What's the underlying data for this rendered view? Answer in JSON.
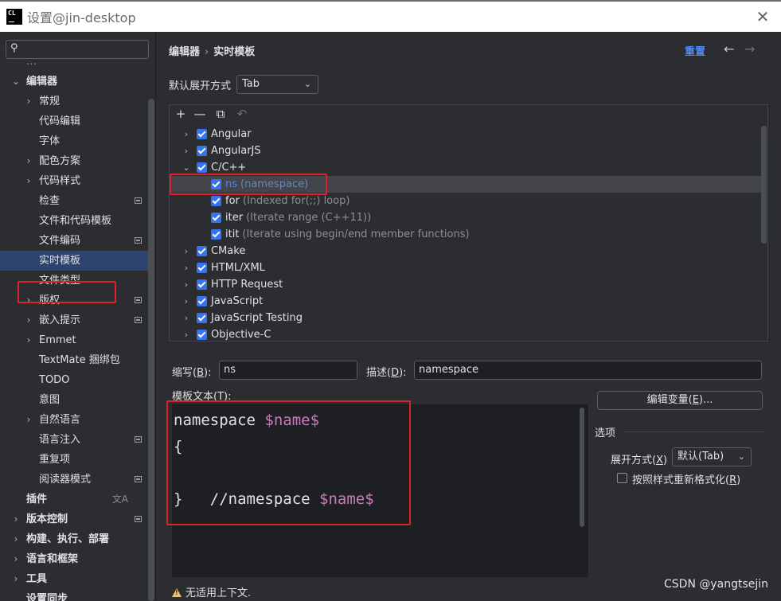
{
  "window": {
    "title": "设置@jin-desktop",
    "app_icon_text": "CL",
    "close": "✕"
  },
  "sidebar": {
    "search_placeholder": "",
    "items": [
      {
        "label": "编辑器",
        "level": 0,
        "bold": true,
        "expanded": true
      },
      {
        "label": "常规",
        "level": 1,
        "chevron": true
      },
      {
        "label": "代码编辑",
        "level": 1
      },
      {
        "label": "字体",
        "level": 1
      },
      {
        "label": "配色方案",
        "level": 1,
        "chevron": true
      },
      {
        "label": "代码样式",
        "level": 1,
        "chevron": true
      },
      {
        "label": "检查",
        "level": 1,
        "mark": true
      },
      {
        "label": "文件和代码模板",
        "level": 1
      },
      {
        "label": "文件编码",
        "level": 1,
        "mark": true
      },
      {
        "label": "实时模板",
        "level": 1,
        "selected": true
      },
      {
        "label": "文件类型",
        "level": 1
      },
      {
        "label": "版权",
        "level": 1,
        "chevron": true,
        "mark": true
      },
      {
        "label": "嵌入提示",
        "level": 1,
        "chevron": true,
        "mark": true
      },
      {
        "label": "Emmet",
        "level": 1,
        "chevron": true
      },
      {
        "label": "TextMate 捆绑包",
        "level": 1
      },
      {
        "label": "TODO",
        "level": 1
      },
      {
        "label": "意图",
        "level": 1
      },
      {
        "label": "自然语言",
        "level": 1,
        "chevron": true
      },
      {
        "label": "语言注入",
        "level": 1,
        "mark": true
      },
      {
        "label": "重复项",
        "level": 1
      },
      {
        "label": "阅读器模式",
        "level": 1,
        "mark": true
      },
      {
        "label": "插件",
        "level": 0,
        "bold": true,
        "translate": true
      },
      {
        "label": "版本控制",
        "level": 0,
        "bold": true,
        "chevron": true,
        "mark": true
      },
      {
        "label": "构建、执行、部署",
        "level": 0,
        "bold": true,
        "chevron": true
      },
      {
        "label": "语言和框架",
        "level": 0,
        "bold": true,
        "chevron": true
      },
      {
        "label": "工具",
        "level": 0,
        "bold": true,
        "chevron": true
      },
      {
        "label": "设置同步",
        "level": 0,
        "bold": true
      }
    ]
  },
  "main": {
    "breadcrumb": {
      "root": "编辑器",
      "sep": "›",
      "current": "实时模板"
    },
    "reset": "重置",
    "nav_back": "←",
    "nav_forward": "→",
    "expand_label": "默认展开方式",
    "expand_value": "Tab",
    "toolbar": {
      "add": "+",
      "remove": "—",
      "copy": "⧉",
      "restore": "↶"
    },
    "templates": [
      {
        "name": "Angular",
        "group": true,
        "expanded": false
      },
      {
        "name": "AngularJS",
        "group": true,
        "expanded": false
      },
      {
        "name": "C/C++",
        "group": true,
        "expanded": true
      },
      {
        "name": "ns",
        "desc": "(namespace)",
        "group": false,
        "selected": true
      },
      {
        "name": "for",
        "desc": "(Indexed for(;;) loop)",
        "group": false
      },
      {
        "name": "iter",
        "desc": "(Iterate range (C++11))",
        "group": false
      },
      {
        "name": "itit",
        "desc": "(Iterate using begin/end member functions)",
        "group": false
      },
      {
        "name": "CMake",
        "group": true,
        "expanded": false
      },
      {
        "name": "HTML/XML",
        "group": true,
        "expanded": false
      },
      {
        "name": "HTTP Request",
        "group": true,
        "expanded": false
      },
      {
        "name": "JavaScript",
        "group": true,
        "expanded": false
      },
      {
        "name": "JavaScript Testing",
        "group": true,
        "expanded": false
      },
      {
        "name": "Objective-C",
        "group": true,
        "expanded": false
      }
    ],
    "abbreviation": {
      "label_pre": "缩写(",
      "label_key": "B",
      "label_post": "):",
      "value": "ns"
    },
    "description": {
      "label_pre": "描述(",
      "label_key": "D",
      "label_post": "):",
      "value": "namespace"
    },
    "template_text": {
      "label_pre": "模板文本(",
      "label_key": "T",
      "label_post": "):",
      "lines": [
        {
          "a": "namespace ",
          "v": "$name$"
        },
        {
          "a": "{",
          "v": ""
        },
        {
          "a": "",
          "v": ""
        },
        {
          "a": "}   //namespace ",
          "v": "$name$"
        }
      ]
    },
    "edit_vars": {
      "pre": "编辑变量(",
      "key": "E",
      "post": ")..."
    },
    "options": {
      "title": "选项",
      "expand_with_pre": "展开方式(",
      "expand_with_key": "X",
      "expand_with_post": ")",
      "expand_with_value": "默认(Tab)",
      "reformat_pre": "按照样式重新格式化(",
      "reformat_key": "R",
      "reformat_post": ")",
      "reformat_checked": false
    },
    "warning": "无适用上下文.",
    "watermark": "CSDN @yangtsejin"
  },
  "colors": {
    "accent": "#548af7",
    "selection": "#2e436e",
    "highlight_box": "#e0202a",
    "checkbox": "#3574f0"
  }
}
